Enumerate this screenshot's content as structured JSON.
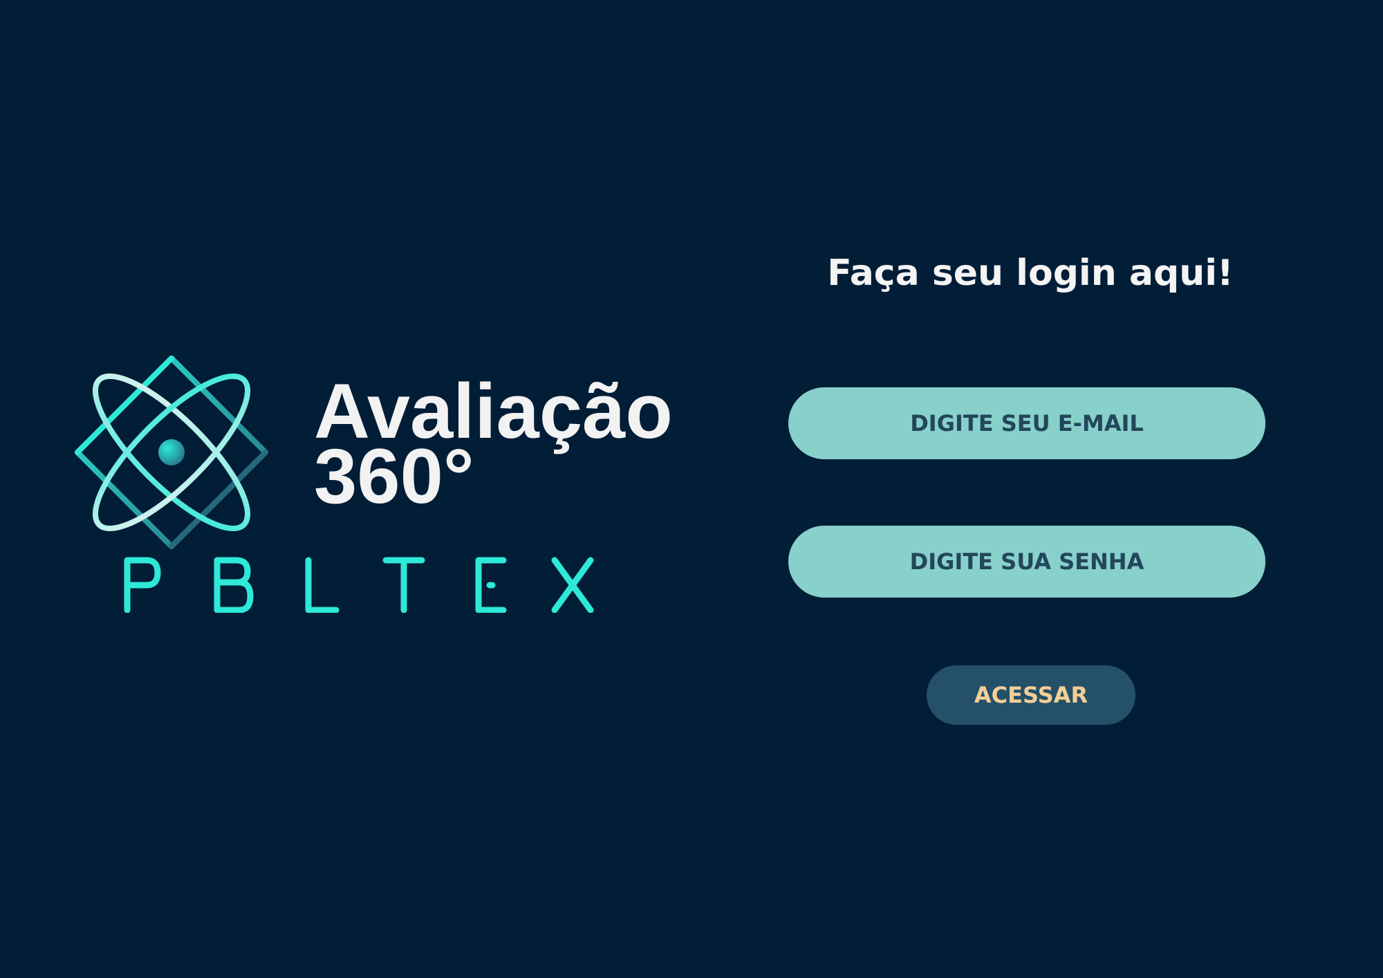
{
  "brand": {
    "title_line1": "Avaliação",
    "title_line2": "360°",
    "wordmark": "PBLTEX",
    "logo_icon": "atom-diamond-icon",
    "colors": {
      "accent": "#2ee8d8",
      "accent_dark": "#256a7d",
      "light": "#e8f4f3"
    }
  },
  "login": {
    "heading": "Faça seu login aqui!",
    "email_placeholder": "DIGITE SEU E-MAIL",
    "password_placeholder": "DIGITE SUA SENHA",
    "submit_label": "ACESSAR"
  },
  "colors": {
    "background": "#021d36",
    "input_fill": "#88d0ca",
    "input_text": "#22465a",
    "button_fill": "#25506a",
    "button_text": "#f4cf95"
  }
}
